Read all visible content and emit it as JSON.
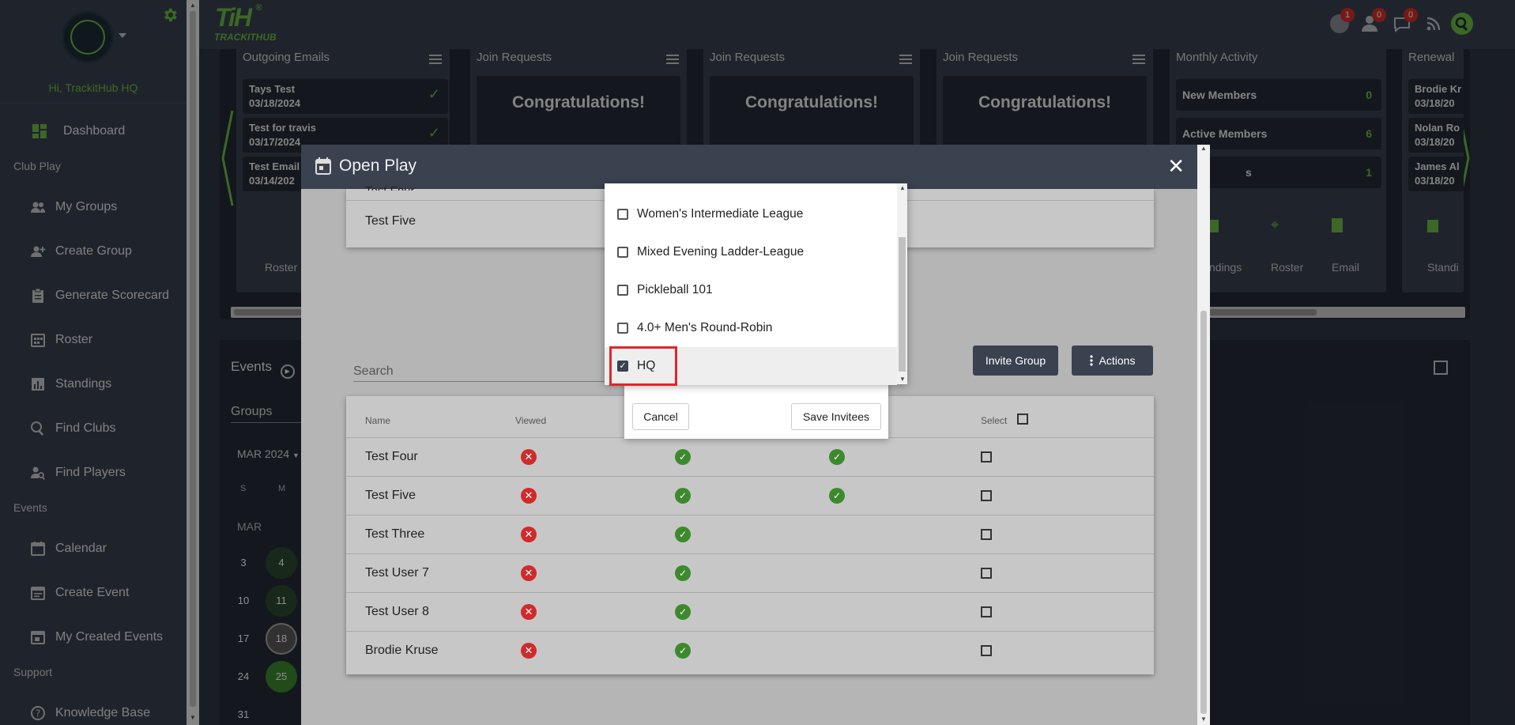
{
  "sidebar": {
    "greeting": "Hi, TrackitHub HQ",
    "sections": {
      "club_play": "Club Play",
      "events": "Events",
      "support": "Support"
    },
    "items": {
      "dashboard": "Dashboard",
      "my_groups": "My Groups",
      "create_group": "Create Group",
      "generate_scorecard": "Generate Scorecard",
      "roster": "Roster",
      "standings": "Standings",
      "find_clubs": "Find Clubs",
      "find_players": "Find Players",
      "calendar": "Calendar",
      "create_event": "Create Event",
      "my_created_events": "My Created Events",
      "knowledge_base": "Knowledge Base"
    }
  },
  "topbar": {
    "logo": "TiH",
    "logo_sub": "TRACKITHUB",
    "badges": {
      "globe": "1",
      "user": "0",
      "chat": "0"
    }
  },
  "cards": {
    "outgoing": {
      "title": "Outgoing Emails",
      "rows": [
        {
          "title": "Tays Test",
          "date": "03/18/2024"
        },
        {
          "title": "Test for travis",
          "date": "03/17/2024"
        },
        {
          "title": "Test Email",
          "date": "03/14/202"
        }
      ],
      "footer": "Roster"
    },
    "join_title": "Join Requests",
    "congrats": "Congratulations!",
    "activity": {
      "title": "Monthly Activity",
      "rows": [
        {
          "label": "New Members",
          "value": "0"
        },
        {
          "label": "Active Members",
          "value": "6"
        },
        {
          "label": "s",
          "value": "1"
        }
      ],
      "footer": [
        "ndings",
        "Roster",
        "Email"
      ]
    },
    "renewals": {
      "title": "Renewal",
      "rows": [
        {
          "title": "Brodie Kr",
          "date": "03/18/20"
        },
        {
          "title": "Nolan Ro",
          "date": "03/18/20"
        },
        {
          "title": "James Al",
          "date": "03/18/20"
        }
      ],
      "footer": "Standi"
    }
  },
  "events": {
    "title": "Events",
    "tab": "Groups",
    "month": "MAR 2024",
    "weekdays": [
      "S",
      "M"
    ],
    "month_label": "MAR",
    "days": [
      [
        "3",
        "4"
      ],
      [
        "10",
        "11"
      ],
      [
        "17",
        "18"
      ],
      [
        "24",
        "25"
      ],
      [
        "31",
        ""
      ]
    ]
  },
  "modal": {
    "title": "Open Play",
    "upper_rows": [
      "Test Four",
      "Test Five"
    ],
    "search_placeholder": "Search",
    "invite_group": "Invite Group",
    "actions": "Actions",
    "columns": {
      "name": "Name",
      "viewed": "Viewed",
      "select": "Select"
    },
    "rows": [
      {
        "name": "Test Four",
        "c2": true,
        "c3": true
      },
      {
        "name": "Test Five",
        "c2": true,
        "c3": true
      },
      {
        "name": "Test Three",
        "c2": true,
        "c3": false
      },
      {
        "name": "Test User 7",
        "c2": true,
        "c3": false
      },
      {
        "name": "Test User 8",
        "c2": true,
        "c3": false
      },
      {
        "name": "Brodie Kruse",
        "c2": true,
        "c3": false
      }
    ]
  },
  "popup": {
    "cancel": "Cancel",
    "save": "Save Invitees",
    "options": [
      {
        "label": "Women's Intermediate League",
        "checked": false
      },
      {
        "label": "Mixed Evening Ladder-League",
        "checked": false
      },
      {
        "label": "Pickleball 101",
        "checked": false
      },
      {
        "label": "4.0+ Men's Round-Robin",
        "checked": false
      },
      {
        "label": "HQ",
        "checked": true
      }
    ]
  },
  "colors": {
    "accent": "#6dbc45",
    "sidebar": "#3a4250",
    "highlight": "#e0262a"
  }
}
